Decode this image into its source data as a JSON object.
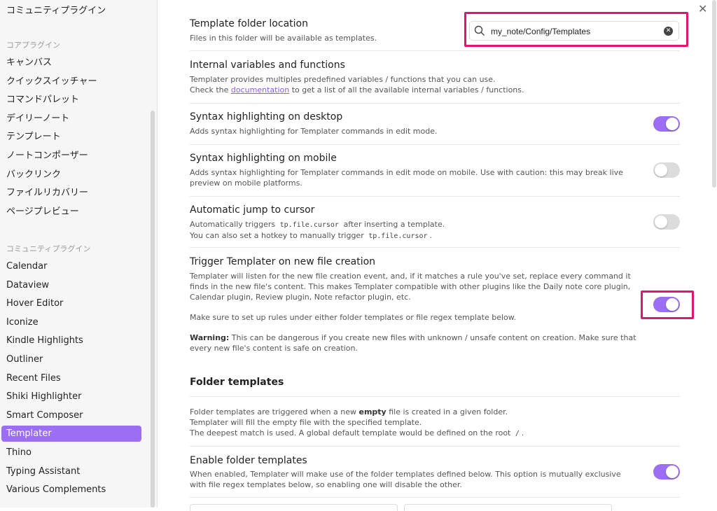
{
  "sidebar": {
    "top_label": "コミュニティプラグイン",
    "core_group": "コアプラグイン",
    "core_items": [
      "キャンバス",
      "クイックスイッチャー",
      "コマンドパレット",
      "デイリーノート",
      "テンプレート",
      "ノートコンポーザー",
      "バックリンク",
      "ファイルリカバリー",
      "ページプレビュー"
    ],
    "community_group": "コミュニティプラグイン",
    "community_items": [
      "Calendar",
      "Dataview",
      "Hover Editor",
      "Iconize",
      "Kindle Highlights",
      "Outliner",
      "Recent Files",
      "Shiki Highlighter",
      "Smart Composer",
      "Templater",
      "Thino",
      "Typing Assistant",
      "Various Complements"
    ],
    "active_item": "Templater"
  },
  "settings": {
    "template_folder": {
      "title": "Template folder location",
      "desc": "Files in this folder will be available as templates.",
      "value": "my_note/Config/Templates"
    },
    "internal_vars": {
      "title": "Internal variables and functions",
      "desc1": "Templater provides multiples predefined variables / functions that you can use.",
      "desc2_pre": "Check the ",
      "desc2_link": "documentation",
      "desc2_post": " to get a list of all the available internal variables / functions."
    },
    "syntax_desktop": {
      "title": "Syntax highlighting on desktop",
      "desc": "Adds syntax highlighting for Templater commands in edit mode.",
      "enabled": true
    },
    "syntax_mobile": {
      "title": "Syntax highlighting on mobile",
      "desc": "Adds syntax highlighting for Templater commands in edit mode on mobile. Use with caution: this may break live preview on mobile platforms.",
      "enabled": false
    },
    "auto_jump": {
      "title": "Automatic jump to cursor",
      "desc1_pre": "Automatically triggers ",
      "desc1_code": "tp.file.cursor",
      "desc1_post": " after inserting a template.",
      "desc2_pre": "You can also set a hotkey to manually trigger ",
      "desc2_code": "tp.file.cursor",
      "desc2_post": ".",
      "enabled": false
    },
    "trigger_new_file": {
      "title": "Trigger Templater on new file creation",
      "desc1": "Templater will listen for the new file creation event, and, if it matches a rule you've set, replace every command it finds in the new file's content. This makes Templater compatible with other plugins like the Daily note core plugin, Calendar plugin, Review plugin, Note refactor plugin, etc.",
      "desc2": "Make sure to set up rules under either folder templates or file regex template below.",
      "warning_label": "Warning:",
      "warning_text": " This can be dangerous if you create new files with unknown / unsafe content on creation. Make sure that every new file's content is safe on creation.",
      "enabled": true
    },
    "folder_templates": {
      "heading": "Folder templates",
      "desc1_pre": "Folder templates are triggered when a new ",
      "desc1_bold": "empty",
      "desc1_post": " file is created in a given folder.",
      "desc2": "Templater will fill the empty file with the specified template.",
      "desc3_pre": "The deepest match is used. A global default template would be defined on the root ",
      "desc3_code": "/",
      "desc3_post": "."
    },
    "enable_folder_templates": {
      "title": "Enable folder templates",
      "desc": "When enabled, Templater will make use of the folder templates defined below. This option is mutually exclusive with file regex templates below, so enabling one will disable the other.",
      "enabled": true
    }
  },
  "colors": {
    "accent": "#9b6ef3",
    "highlight": "#e0156e"
  },
  "icons": {
    "close": "close-icon",
    "search": "search-icon",
    "clear": "clear-icon"
  }
}
